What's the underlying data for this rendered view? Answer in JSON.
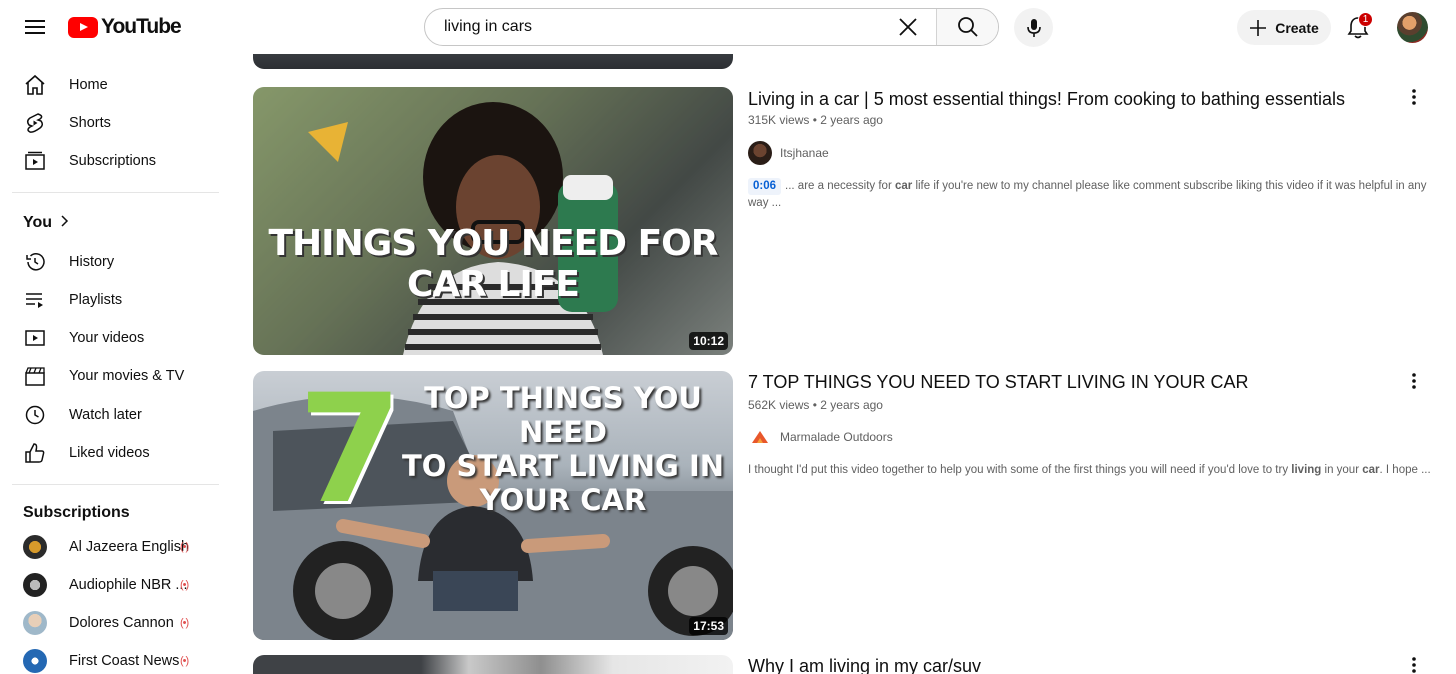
{
  "header": {
    "logo_text": "YouTube",
    "search_value": "living in cars",
    "create_label": "Create",
    "notification_count": "1"
  },
  "sidebar": {
    "main": [
      {
        "label": "Home",
        "icon": "home-icon"
      },
      {
        "label": "Shorts",
        "icon": "shorts-icon"
      },
      {
        "label": "Subscriptions",
        "icon": "subscriptions-icon"
      }
    ],
    "you_title": "You",
    "you_items": [
      {
        "label": "History",
        "icon": "history-icon"
      },
      {
        "label": "Playlists",
        "icon": "playlists-icon"
      },
      {
        "label": "Your videos",
        "icon": "your-videos-icon"
      },
      {
        "label": "Your movies & TV",
        "icon": "movies-icon"
      },
      {
        "label": "Watch later",
        "icon": "clock-icon"
      },
      {
        "label": "Liked videos",
        "icon": "thumbs-up-icon"
      }
    ],
    "subscriptions_title": "Subscriptions",
    "subscriptions": [
      {
        "label": "Al Jazeera English",
        "live": true
      },
      {
        "label": "Audiophile NBR ...",
        "live": true
      },
      {
        "label": "Dolores Cannon",
        "live": true
      },
      {
        "label": "First Coast News",
        "live": true
      }
    ]
  },
  "results": [
    {
      "title": "Living in a car | 5 most essential things! From cooking to bathing essentials",
      "views": "315K views",
      "age": "2 years ago",
      "channel": "Itsjhanae",
      "timestamp_chip": "0:06",
      "snippet_before": "... are a necessity for ",
      "snippet_bold1": "car",
      "snippet_after": " life if you're new to my channel please like comment subscribe liking this video if it was helpful in any way ...",
      "duration": "10:12",
      "thumb_text": "THINGS YOU NEED FOR CAR LIFE"
    },
    {
      "title": "7 TOP THINGS YOU NEED TO START LIVING IN YOUR CAR",
      "views": "562K views",
      "age": "2 years ago",
      "channel": "Marmalade Outdoors",
      "snippet_before": "I thought I'd put this video together to help you with some of the first things you will need if you'd love to try ",
      "snippet_bold1": "living",
      "snippet_mid": " in your ",
      "snippet_bold2": "car",
      "snippet_after": ". I hope ...",
      "duration": "17:53",
      "thumb_number": "7",
      "thumb_line1": "TOP THINGS YOU NEED",
      "thumb_line2": "TO START LIVING IN",
      "thumb_line3": "YOUR CAR"
    },
    {
      "title": "Why I am living in my car/suv"
    }
  ],
  "colors": {
    "brand_red": "#ff0000",
    "live_red": "#e05050",
    "link_blue": "#065fd4"
  }
}
